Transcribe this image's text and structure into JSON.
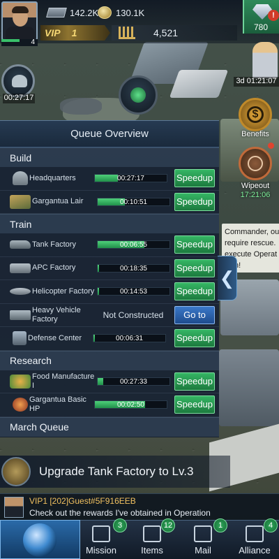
{
  "hud": {
    "player_level": "4",
    "steel": "142.2K",
    "food": "130.1K",
    "vip_label": "VIP",
    "vip_level": "1",
    "power": "4,521",
    "gems": "780",
    "gem_alert": "!"
  },
  "side": {
    "radar_timer": "00:27:17",
    "general_timer": "3d 01:21:07",
    "benefits_label": "Benefits",
    "wipeout_label": "Wipeout",
    "wipeout_timer": "17:21:06",
    "notice_lines": [
      "Commander, ou",
      "require rescue.",
      "execute Operat",
      "icon!"
    ]
  },
  "queue": {
    "title": "Queue Overview",
    "build": {
      "header": "Build",
      "items": [
        {
          "name": "Headquarters",
          "time": "00:27:17",
          "progress": 0.32,
          "action": "Speedup",
          "icon": "headquarters-icon"
        },
        {
          "name": "Gargantua Lair",
          "time": "00:10:51",
          "progress": 0.38,
          "action": "Speedup",
          "icon": "lair-icon"
        }
      ]
    },
    "train": {
      "header": "Train",
      "items": [
        {
          "name": "Tank Factory",
          "time": "00:06:55",
          "progress": 0.65,
          "action": "Speedup",
          "icon": "tank-icon"
        },
        {
          "name": "APC Factory",
          "time": "00:18:35",
          "progress": 0.02,
          "action": "Speedup",
          "icon": "apc-icon"
        },
        {
          "name": "Helicopter Factory",
          "time": "00:14:53",
          "progress": 0.02,
          "action": "Speedup",
          "icon": "helicopter-icon"
        },
        {
          "name": "Heavy Vehicle Factory",
          "status": "Not Constructed",
          "action": "Go to",
          "icon": "heavy-vehicle-icon"
        },
        {
          "name": "Defense Center",
          "time": "00:06:31",
          "progress": 0.02,
          "action": "Speedup",
          "icon": "defense-center-icon"
        }
      ]
    },
    "research": {
      "header": "Research",
      "items": [
        {
          "name": "Food Manufacture I",
          "time": "00:27:33",
          "progress": 0.08,
          "action": "Speedup",
          "icon": "food-manufacture-icon"
        },
        {
          "name": "Gargantua Basic HP",
          "time": "00:02:50",
          "progress": 0.7,
          "action": "Speedup",
          "icon": "gargantua-icon"
        }
      ]
    },
    "march_header": "March Queue"
  },
  "upgrade_prompt": "Upgrade Tank Factory to Lv.3",
  "chat": {
    "sender": "VIP1 [202]Guest#5F916EEB",
    "message": "Check out the rewards I've obtained in Operation"
  },
  "nav": {
    "items": [
      {
        "label": "Mission",
        "badge": "3"
      },
      {
        "label": "Items",
        "badge": "12"
      },
      {
        "label": "Mail",
        "badge": "1"
      },
      {
        "label": "Alliance",
        "badge": "4"
      }
    ]
  },
  "colors": {
    "speedup_green": "#1c7a3e",
    "goto_blue": "#1e4c8e",
    "progress_green": "#21904a",
    "panel_bg": "#16202e"
  }
}
